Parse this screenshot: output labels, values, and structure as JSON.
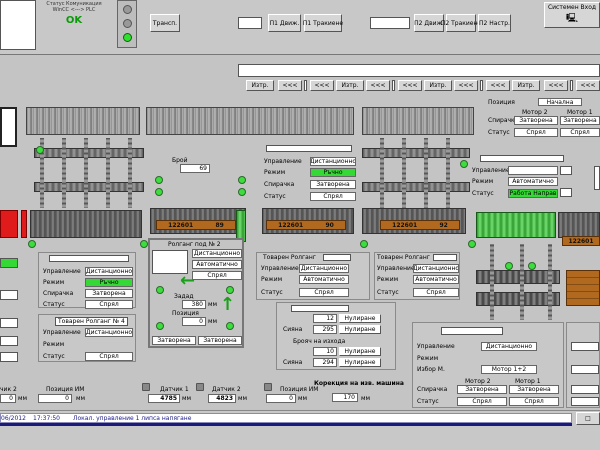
{
  "comm": {
    "title": "Статус Комуникация",
    "subtitle": "WinCC <---> PLC",
    "status": "OK"
  },
  "top_buttons": {
    "transp": "Трансп.",
    "p1_dvij": "П1 Движ.",
    "p1_trakiane": "П1 Тракиене",
    "p2_dvij": "П2 Движ.",
    "p2_trakiane": "П2 Тракиене",
    "p2_nastr": "П2 Настр.",
    "system": "Системен Вход"
  },
  "nav_bar": {
    "izt": "Изтр.",
    "back": "<<<"
  },
  "green_labels": {
    "rachno": "Ръчно",
    "rabota_naprav": "Работа Направ"
  },
  "panels": {
    "top_center": {
      "upr": "Управление",
      "upr_val": "Дистанционно",
      "rej": "Режим",
      "rej_val": "Ръчно",
      "spir": "Спирачка",
      "spir_val": "Затворена",
      "status": "Статус",
      "status_val": "Спрял"
    },
    "top_right": {
      "poziciya": "Позиция",
      "poziciya_val": "Начална",
      "motor2": "Мотор 2",
      "motor1": "Мотор 1",
      "spir": "Спирачка",
      "spir_m2": "Затворена",
      "spir_m1": "Затворена",
      "status": "Статус",
      "status_m2": "Спрял",
      "status_m1": "Спрял"
    },
    "right_mid": {
      "upr": "Управление",
      "rej": "Режим",
      "rej_val": "Автоматично",
      "status": "Статус"
    },
    "left_lower": {
      "upr": "Управление",
      "upr_val": "Дистанционно",
      "rej": "Режим",
      "rej_val": "Ръчно",
      "spir": "Спирачка",
      "spir_val": "Затворена",
      "status": "Статус",
      "status_val": "Спрял"
    },
    "left_bottom": {
      "title": "Товарен Ролганг № 4",
      "upr": "Управление",
      "upr_val": "Дистанционно",
      "rej": "Режим",
      "status": "Статус",
      "status_val": "Спрял"
    },
    "rolgang2": {
      "title": "Ролганг под № 2",
      "upr_val": "Дистанционно",
      "rej_val": "Автоматично",
      "status_val": "Спрял",
      "zadad": "Задад",
      "zadad_val": "380",
      "zadad_unit": "мм",
      "pozic": "Позиция",
      "pozic_val": "0",
      "pozic_unit": "мм",
      "z1": "Затворена",
      "z2": "Затворена"
    },
    "tovaren_a": {
      "title": "Товарен Ролганг",
      "upr": "Управление",
      "upr_val": "Дистанционно",
      "rej": "Режим",
      "rej_val": "Автоматично",
      "status": "Статус",
      "status_val": "Спрял"
    },
    "tovaren_b": {
      "title": "Товарен Ролганг",
      "upr": "Управление",
      "upr_val": "Дистанционно",
      "rej": "Режим",
      "rej_val": "Автоматично",
      "status": "Статус",
      "status_val": "Спрял"
    },
    "counter": {
      "row1_val": "12",
      "row1_btn": "Нулиране",
      "row2": "Сияна",
      "row2_val": "295",
      "row2_btn": "Нулиране",
      "title2": "Брояч на изхода",
      "row3_val": "10",
      "row3_btn": "Нулиране",
      "row4": "Сияна",
      "row4_val": "294",
      "row4_btn": "Нулиране"
    },
    "bottom_right": {
      "upr": "Управление",
      "upr_val": "Дистанционно",
      "rej": "Режим",
      "izbor": "Избор М.",
      "izbor_val": "Мотор 1+2",
      "motor2": "Мотор 2",
      "motor1": "Мотор 1",
      "spir": "Спирачка",
      "spir_m2": "Затворена",
      "spir_m1": "Затворена",
      "status": "Статус",
      "status_m2": "Спрял",
      "status_m1": "Спрял"
    }
  },
  "broi": {
    "label": "Брой",
    "value": "69"
  },
  "bar_labels": {
    "b1": "122601",
    "b1v": "89",
    "b2": "122601",
    "b2v": "90",
    "b3": "122601",
    "b3v": "92",
    "b4": "122601"
  },
  "sensors": {
    "d1": "Датчик 1",
    "d1_val": "4785",
    "d2": "Датчик 2",
    "d2_val": "4823",
    "pos_l": "Позиция ИМ",
    "pos_l_val": "0",
    "pos_c": "Позиция ИМ",
    "pos_c_val": "0",
    "left_d": "чик 2",
    "left_v": "0",
    "unit": "мм"
  },
  "correction": {
    "label": "Корекция на изв. машина",
    "value": "170",
    "unit": "мм"
  },
  "status_bar": {
    "date": "06/2012",
    "time": "17:37:50",
    "message": "Локал. управление 1 липса напягане"
  }
}
